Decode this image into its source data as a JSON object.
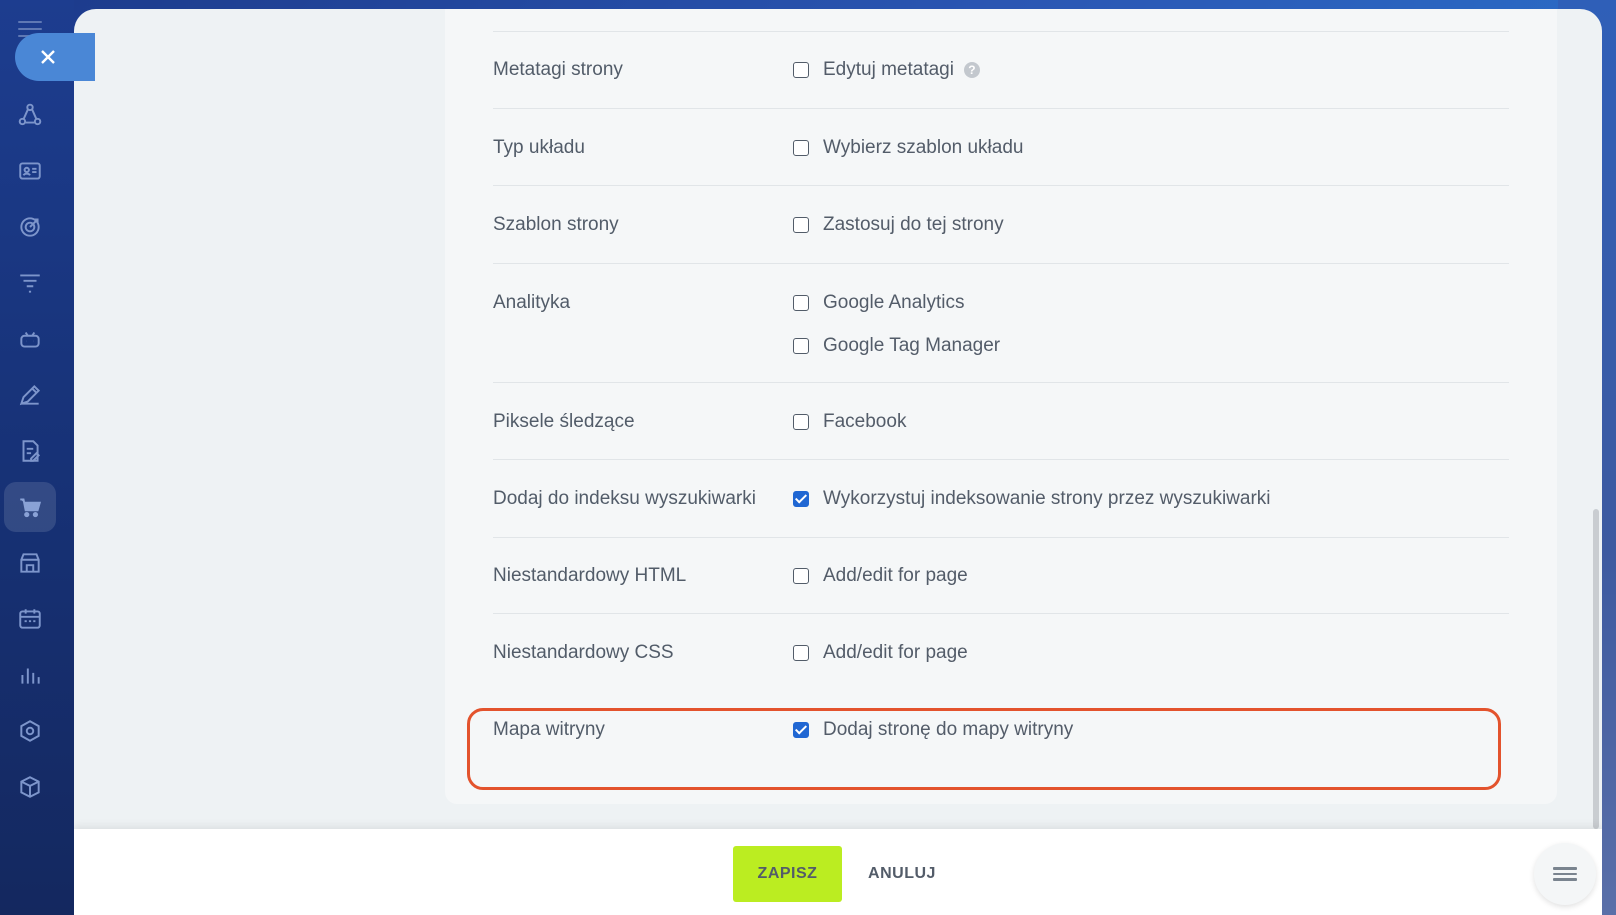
{
  "sidebar": {
    "close_icon": "close-icon",
    "items": [
      {
        "icon": "crm-icon"
      },
      {
        "icon": "contact-card-icon"
      },
      {
        "icon": "target-icon"
      },
      {
        "icon": "funnel-icon"
      },
      {
        "icon": "robot-icon"
      },
      {
        "icon": "pen-icon"
      },
      {
        "icon": "document-icon"
      },
      {
        "icon": "cart-icon",
        "active": true
      },
      {
        "icon": "store-icon"
      },
      {
        "icon": "calendar-icon"
      },
      {
        "icon": "chart-icon"
      },
      {
        "icon": "hexagon-icon"
      },
      {
        "icon": "cube-icon"
      }
    ]
  },
  "settings": {
    "rows": [
      {
        "label": "Metatagi strony",
        "options": [
          {
            "text": "Edytuj metatagi",
            "checked": false,
            "help": true
          }
        ]
      },
      {
        "label": "Typ układu",
        "options": [
          {
            "text": "Wybierz szablon układu",
            "checked": false
          }
        ]
      },
      {
        "label": "Szablon strony",
        "options": [
          {
            "text": "Zastosuj do tej strony",
            "checked": false
          }
        ]
      },
      {
        "label": "Analityka",
        "options": [
          {
            "text": "Google Analytics",
            "checked": false
          },
          {
            "text": "Google Tag Manager",
            "checked": false
          }
        ]
      },
      {
        "label": "Piksele śledzące",
        "options": [
          {
            "text": "Facebook",
            "checked": false
          }
        ]
      },
      {
        "label": "Dodaj do indeksu wyszukiwarki",
        "options": [
          {
            "text": "Wykorzystuj indeksowanie strony przez wyszukiwarki",
            "checked": true
          }
        ]
      },
      {
        "label": "Niestandardowy HTML",
        "options": [
          {
            "text": "Add/edit for page",
            "checked": false
          }
        ]
      },
      {
        "label": "Niestandardowy CSS",
        "options": [
          {
            "text": "Add/edit for page",
            "checked": false
          }
        ]
      },
      {
        "label": "Mapa witryny",
        "options": [
          {
            "text": "Dodaj stronę do mapy witryny",
            "checked": true
          }
        ]
      }
    ],
    "help_glyph": "?"
  },
  "footer": {
    "save_label": "ZAPISZ",
    "cancel_label": "ANULUJ"
  },
  "colors": {
    "accent_checkbox": "#2067d3",
    "save_button": "#bbed21",
    "highlight_border": "#e3532d"
  }
}
